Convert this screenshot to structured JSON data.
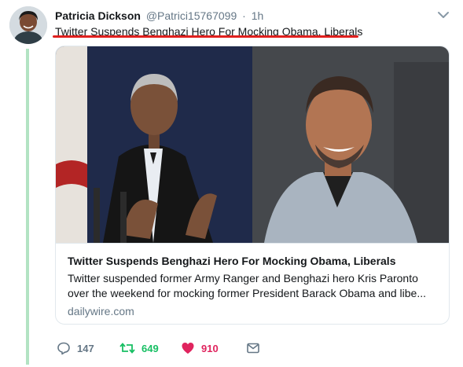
{
  "tweet": {
    "display_name": "Patricia Dickson",
    "handle": "@Patrici15767099",
    "separator": "·",
    "time": "1h",
    "text": "Twitter Suspends Benghazi Hero For Mocking Obama, Liberals"
  },
  "card": {
    "title": "Twitter Suspends Benghazi Hero For Mocking Obama, Liberals",
    "description_line1": "Twitter suspended former Army Ranger and Benghazi hero Kris Paronto",
    "description_line2": "over the weekend for mocking former President Barack Obama and libe...",
    "domain": "dailywire.com"
  },
  "actions": {
    "reply_count": "147",
    "retweet_count": "649",
    "like_count": "910"
  },
  "colors": {
    "retweet": "#17bf63",
    "like": "#e0245e",
    "thread_line": "#b3e3c3",
    "annotation_underline": "#e0201e",
    "muted": "#657786"
  },
  "icons": [
    "chevron-down-icon",
    "reply-icon",
    "retweet-icon",
    "heart-icon",
    "mail-icon"
  ]
}
